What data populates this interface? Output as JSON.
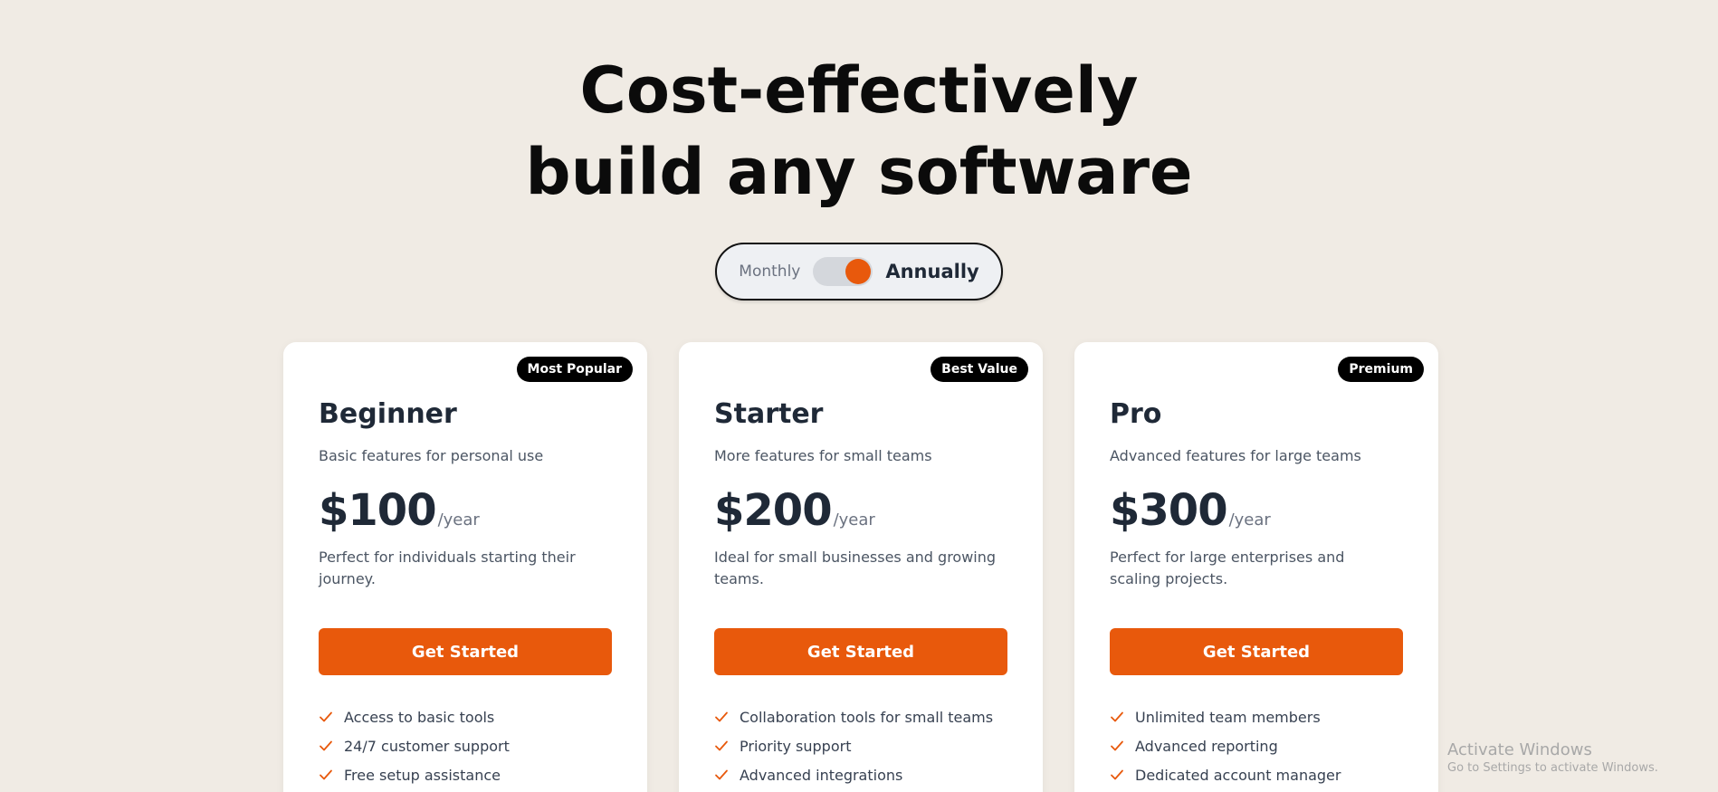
{
  "hero": {
    "line1": "Cost-effectively",
    "line2": "build any software"
  },
  "billing_toggle": {
    "off_label": "Monthly",
    "on_label": "Annually",
    "selected": "Annually"
  },
  "colors": {
    "accent": "#e8590c",
    "background": "#f0ebe4",
    "badge": "#000000"
  },
  "plans": [
    {
      "badge": "Most Popular",
      "name": "Beginner",
      "description": "Basic features for personal use",
      "price": "$100",
      "period": "/year",
      "note": "Perfect for individuals starting their journey.",
      "cta": "Get Started",
      "features": [
        "Access to basic tools",
        "24/7 customer support",
        "Free setup assistance"
      ]
    },
    {
      "badge": "Best Value",
      "name": "Starter",
      "description": "More features for small teams",
      "price": "$200",
      "period": "/year",
      "note": "Ideal for small businesses and growing teams.",
      "cta": "Get Started",
      "features": [
        "Collaboration tools for small teams",
        "Priority support",
        "Advanced integrations"
      ]
    },
    {
      "badge": "Premium",
      "name": "Pro",
      "description": "Advanced features for large teams",
      "price": "$300",
      "period": "/year",
      "note": "Perfect for large enterprises and scaling projects.",
      "cta": "Get Started",
      "features": [
        "Unlimited team members",
        "Advanced reporting",
        "Dedicated account manager"
      ]
    }
  ],
  "watermark": {
    "title": "Activate Windows",
    "subtitle": "Go to Settings to activate Windows."
  }
}
